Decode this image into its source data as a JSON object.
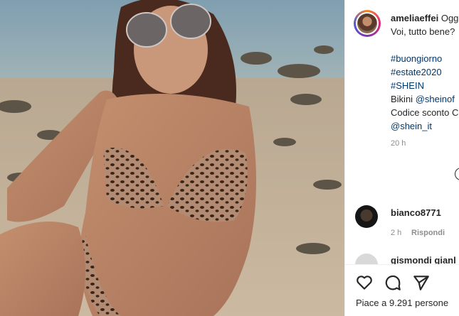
{
  "post": {
    "image_alt_icon": "post-photo",
    "caption": {
      "username": "ameliaeffei",
      "line1": "Oggi",
      "line2": "Voi, tutto bene?",
      "hashtags": [
        "#buongiorno",
        "#estate2020",
        "#SHEIN"
      ],
      "bikini_label": "Bikini",
      "bikini_mention": "@sheinof",
      "discount_text": "Codice sconto C",
      "mention2": "@shein_it"
    },
    "time": "20 h",
    "more_icon": "plus-circle-icon"
  },
  "comments": [
    {
      "username": "bianco8771",
      "time": "2 h",
      "reply_label": "Rispondi"
    },
    {
      "username": "gismondi gianl"
    }
  ],
  "actions": {
    "icons": [
      "heart-icon",
      "comment-icon",
      "share-icon"
    ],
    "likes": "Piace a 9.291 persone"
  },
  "colors": {
    "link": "#00376b",
    "muted": "#8e8e8e",
    "text": "#262626"
  }
}
